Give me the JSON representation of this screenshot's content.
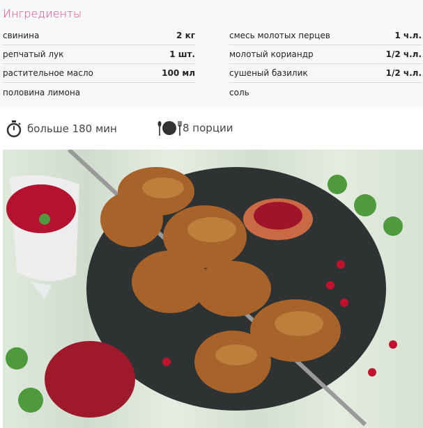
{
  "ingredients": {
    "title": "Ингредиенты",
    "left": [
      {
        "name": "свинина",
        "qty": "2 кг"
      },
      {
        "name": "репчатый лук",
        "qty": "1 шт."
      },
      {
        "name": "растительное масло",
        "qty": "100 мл"
      },
      {
        "name": "половина лимона",
        "qty": ""
      }
    ],
    "right": [
      {
        "name": "смесь молотых перцев",
        "qty": "1 ч.л."
      },
      {
        "name": "молотый кориандр",
        "qty": "1/2 ч.л."
      },
      {
        "name": "сушеный базилик",
        "qty": "1/2 ч.л."
      },
      {
        "name": "соль",
        "qty": ""
      }
    ]
  },
  "meta": {
    "time": "больше 180 мин",
    "servings": "8 порции"
  },
  "colors": {
    "accent": "#e8467c"
  }
}
